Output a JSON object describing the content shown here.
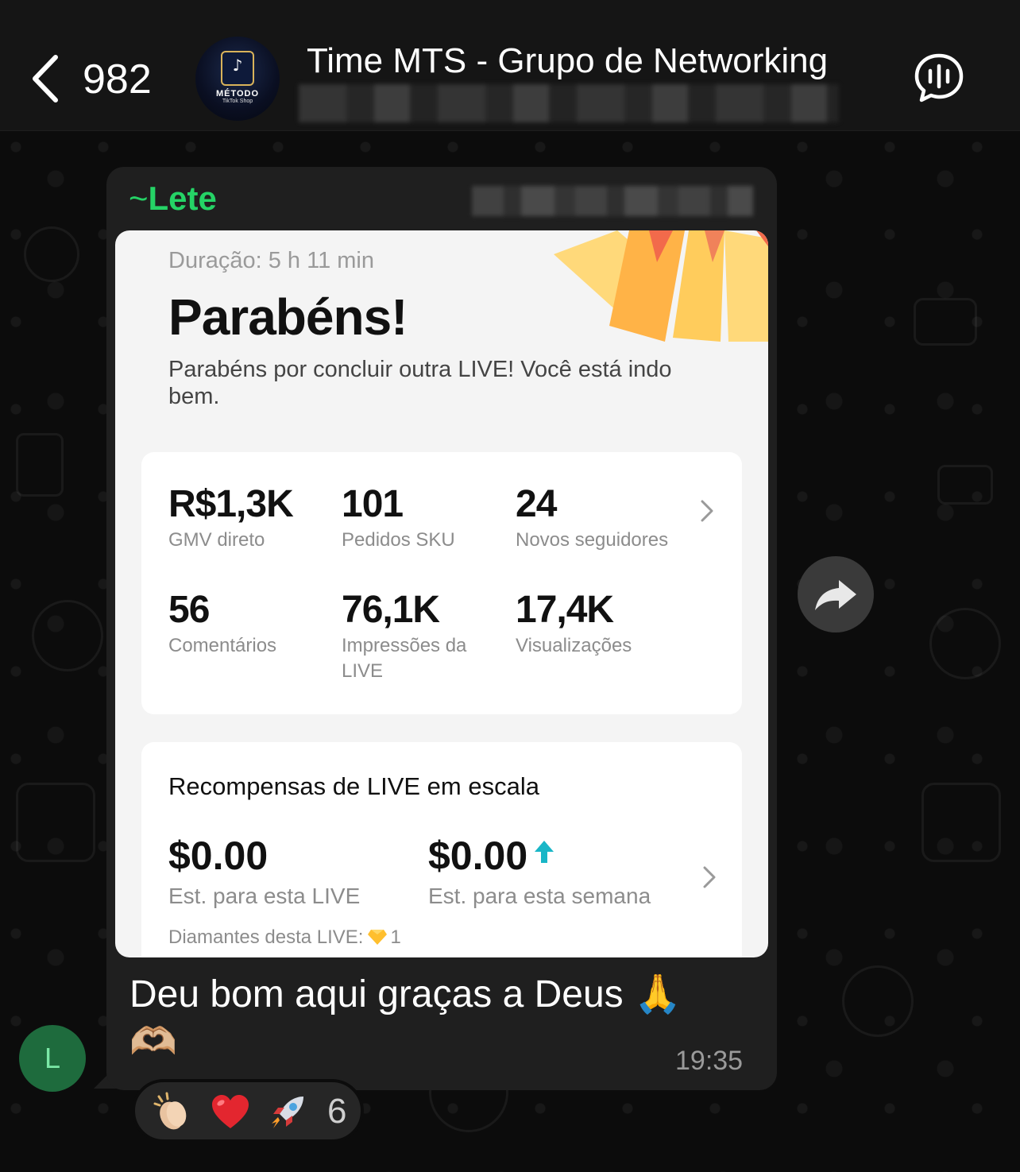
{
  "header": {
    "back_count": "982",
    "group_title": "Time MTS - Grupo de Networking",
    "avatar": {
      "line1": "MÉTODO",
      "line2": "TikTok Shop",
      "icon": "tiktok-note-icon"
    }
  },
  "message": {
    "sender_name": "Lete",
    "sender_prefix": "~",
    "sender_initial": "L",
    "caption": "Deu bom aqui graças a Deus 🙏 🫶🏼",
    "time": "19:35",
    "colors": {
      "sender": "#25d366",
      "bubble": "#1f1f1f"
    }
  },
  "screenshot": {
    "duration": "Duração: 5 h 11 min",
    "title": "Parabéns!",
    "subtitle": "Parabéns por concluir outra LIVE! Você está indo bem.",
    "stats": [
      {
        "value": "R$1,3K",
        "label": "GMV direto"
      },
      {
        "value": "101",
        "label": "Pedidos SKU"
      },
      {
        "value": "24",
        "label": "Novos seguidores"
      },
      {
        "value": "56",
        "label": "Comentários"
      },
      {
        "value": "76,1K",
        "label": "Impressões da LIVE"
      },
      {
        "value": "17,4K",
        "label": "Visualizações"
      }
    ],
    "rewards": {
      "title": "Recompensas de LIVE em escala",
      "live_value": "$0.00",
      "live_label": "Est. para esta LIVE",
      "week_value": "$0.00",
      "week_label": "Est. para esta semana",
      "diamonds_label": "Diamantes desta LIVE:",
      "diamonds_count": "1",
      "accent": "#19b6c7"
    }
  },
  "reactions": {
    "items": [
      "clapping-hands-icon",
      "red-heart-icon",
      "rocket-icon"
    ],
    "count": "6"
  }
}
